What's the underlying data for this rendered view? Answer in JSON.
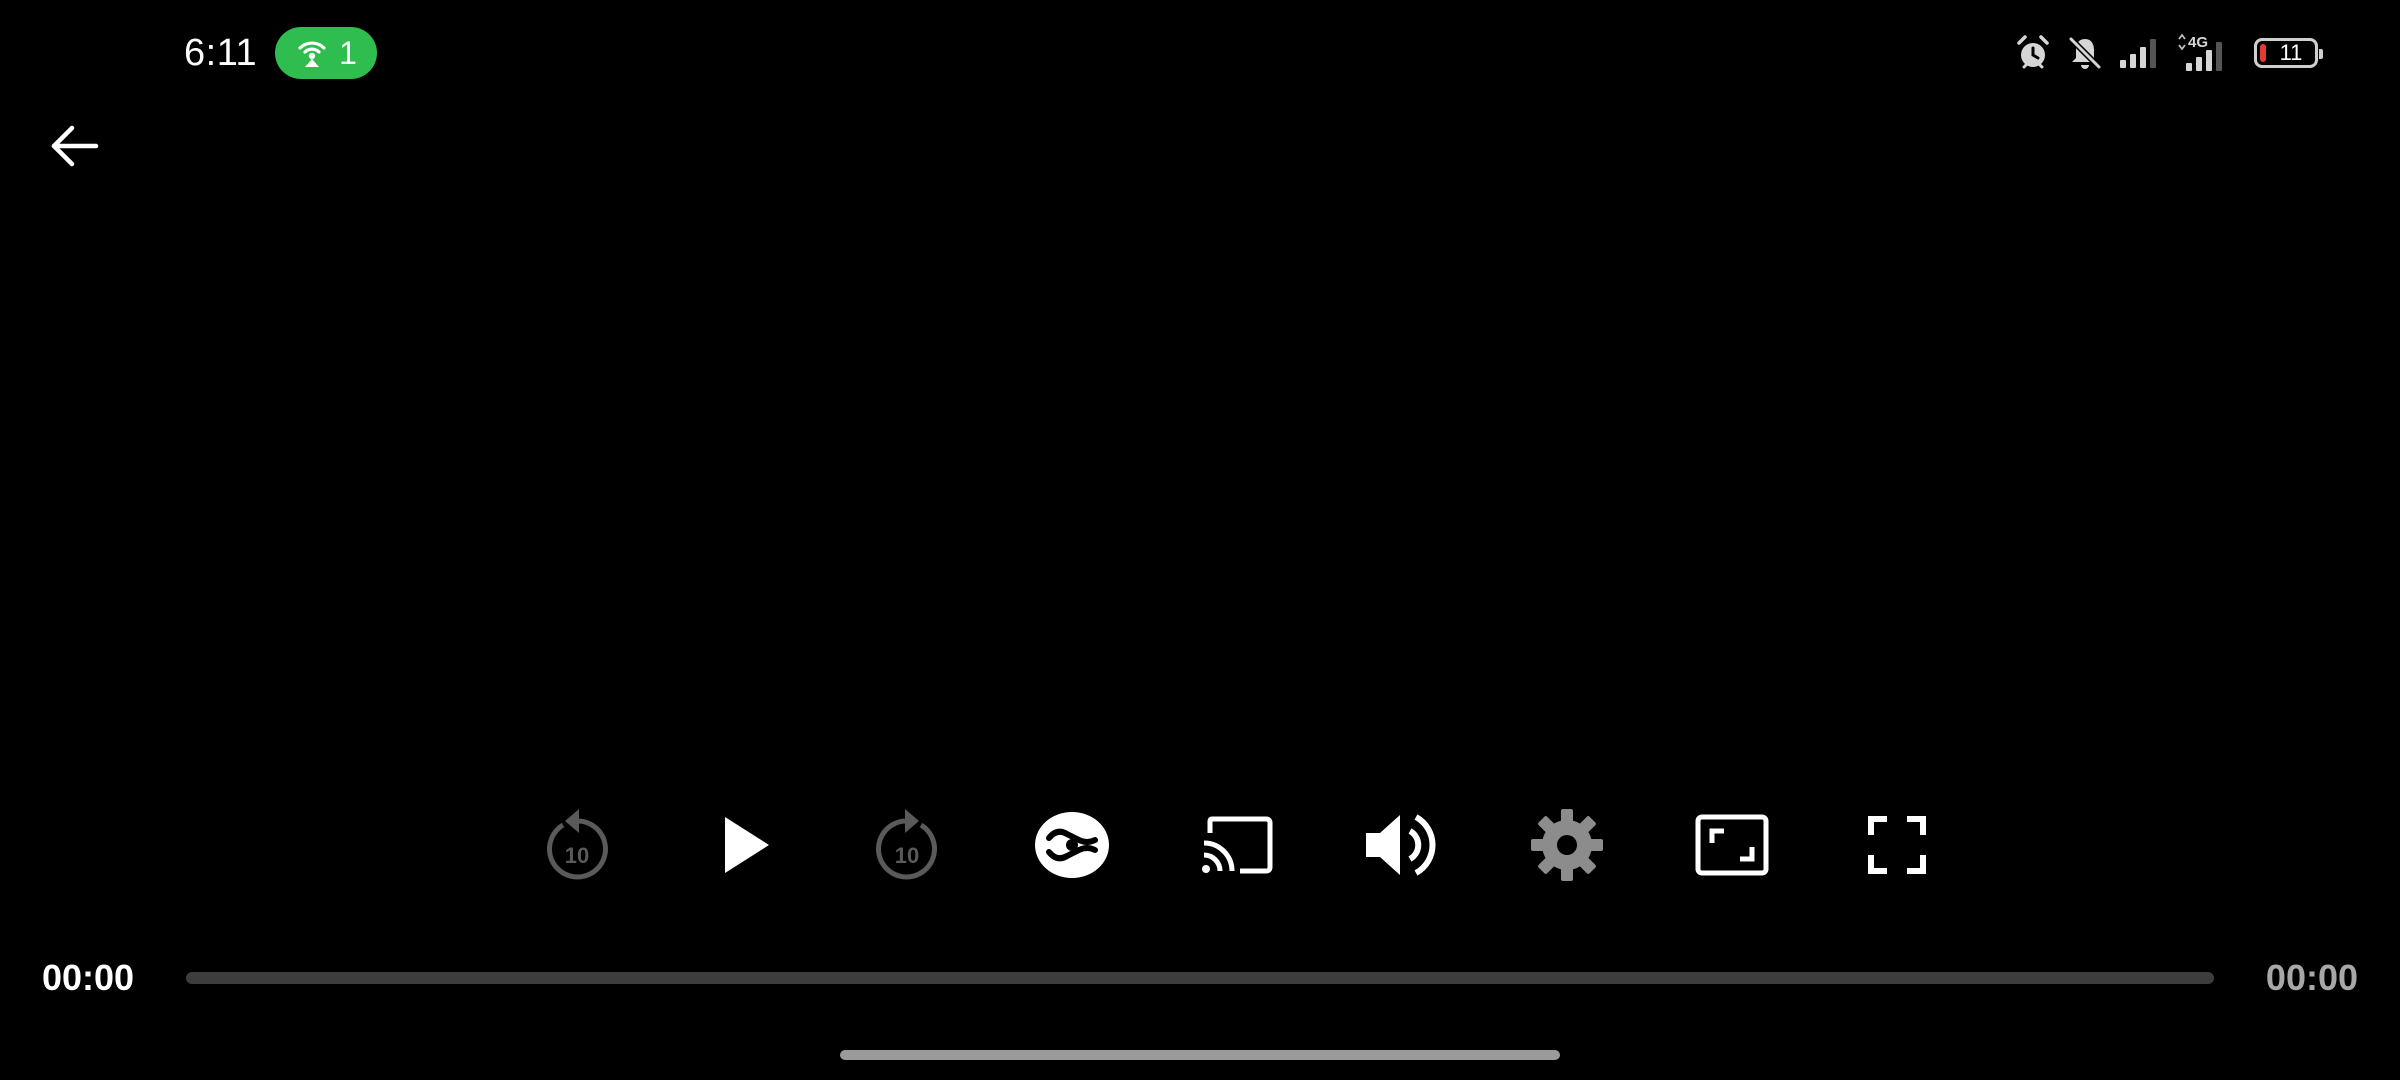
{
  "status_bar": {
    "time": "6:11",
    "hotspot": {
      "count": "1",
      "color": "#2fbd4f",
      "icon": "hotspot-icon"
    },
    "icons": [
      "alarm-icon",
      "notifications-muted-icon",
      "signal-icon",
      "signal-4g-icon"
    ],
    "network_label": "4G",
    "battery": {
      "level_text": "11",
      "level_percent": 11,
      "low_color": "#e53935"
    }
  },
  "navigation": {
    "back_icon": "arrow-left-icon"
  },
  "player": {
    "controls": [
      {
        "name": "rewind-10-button",
        "icon": "replay-10-icon",
        "label": "10",
        "enabled": false
      },
      {
        "name": "play-button",
        "icon": "play-icon",
        "enabled": true
      },
      {
        "name": "forward-10-button",
        "icon": "forward-10-icon",
        "label": "10",
        "enabled": false
      },
      {
        "name": "ad-skip-button",
        "icon": "cast-link-icon",
        "enabled": true
      },
      {
        "name": "cast-button",
        "icon": "cast-icon",
        "enabled": true
      },
      {
        "name": "volume-button",
        "icon": "volume-up-icon",
        "enabled": true
      },
      {
        "name": "settings-button",
        "icon": "gear-icon",
        "enabled": true
      },
      {
        "name": "picture-in-picture-button",
        "icon": "picture-in-picture-icon",
        "enabled": true
      },
      {
        "name": "fullscreen-button",
        "icon": "fullscreen-icon",
        "enabled": true
      }
    ],
    "current_time": "00:00",
    "duration": "00:00",
    "progress_percent": 0,
    "colors": {
      "active": "#ffffff",
      "disabled": "#5a5a5a",
      "settings": "#8c8c8c",
      "track": "#3d3d3d"
    }
  }
}
